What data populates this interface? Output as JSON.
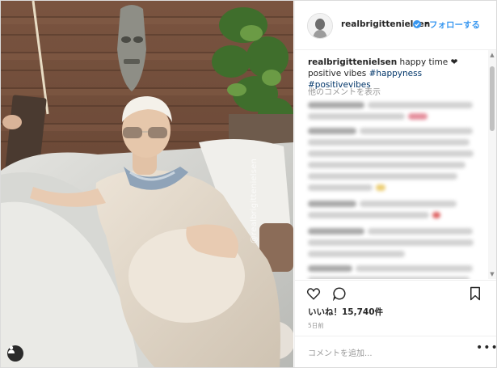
{
  "post": {
    "username": "realbrigittenielsen",
    "follow_label": "フォローする",
    "caption_text": "happy time ❤ positive vibes",
    "hashtags": "#happyness #positivevibes",
    "view_more": "他のコメントを表示",
    "likes": "いいね！15,740件",
    "time_ago": "5日前",
    "add_comment_placeholder": "コメントを追加...",
    "watermark": "@realbrigittenielsen",
    "dot": "•"
  },
  "icons": {
    "verified": "verified-badge-icon",
    "heart": "heart-icon",
    "comment": "comment-icon",
    "bookmark": "bookmark-icon",
    "user_tag": "user-tag-icon",
    "options": "more-options-icon"
  },
  "colors": {
    "link_blue": "#3897f0",
    "text": "#262626",
    "muted": "#999999",
    "border": "#efefef"
  }
}
